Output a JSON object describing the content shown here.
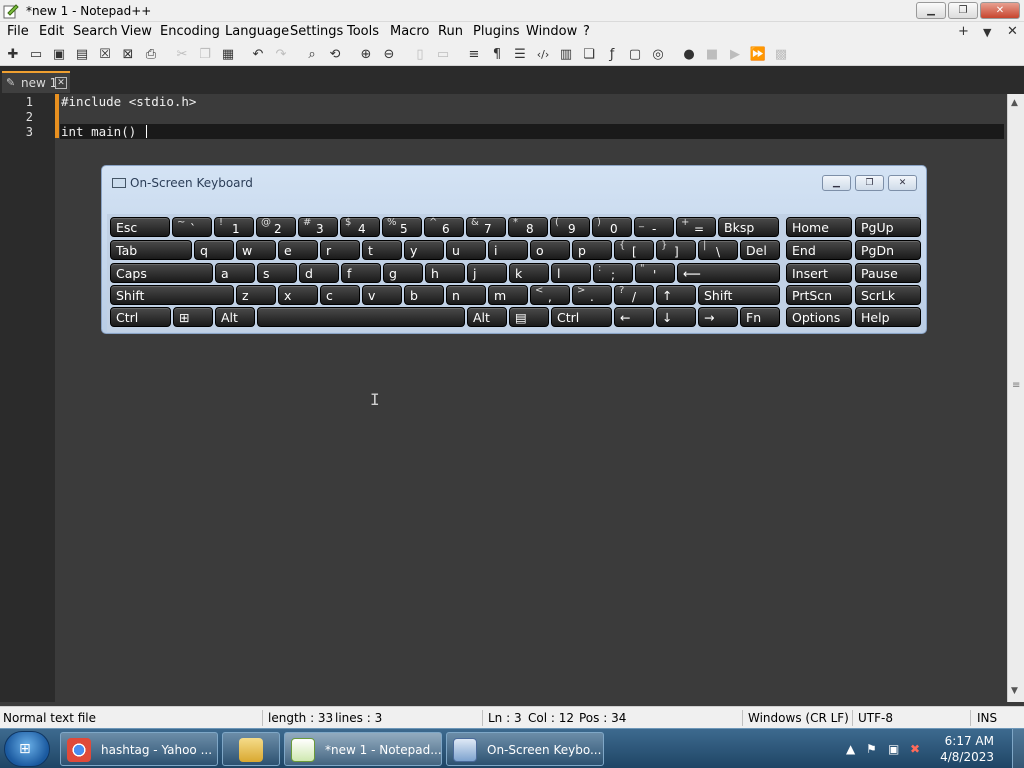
{
  "window": {
    "title": "*new 1 - Notepad++",
    "buttons": {
      "minimize": "▁",
      "maximize": "❐",
      "close": "✕"
    }
  },
  "menubar": {
    "items": [
      "File",
      "Edit",
      "Search",
      "View",
      "Encoding",
      "Language",
      "Settings",
      "Tools",
      "Macro",
      "Run",
      "Plugins",
      "Window",
      "?"
    ],
    "right": {
      "add": "+",
      "dropdown": "▼",
      "close": "✕"
    }
  },
  "toolbar": {
    "icons": [
      {
        "name": "new-file-icon",
        "glyph": "✚"
      },
      {
        "name": "open-file-icon",
        "glyph": "▭"
      },
      {
        "name": "save-icon",
        "glyph": "▣"
      },
      {
        "name": "save-all-icon",
        "glyph": "▤"
      },
      {
        "name": "close-file-icon",
        "glyph": "☒"
      },
      {
        "name": "close-all-icon",
        "glyph": "⊠"
      },
      {
        "name": "print-icon",
        "glyph": "⎙"
      },
      {
        "name": "cut-icon",
        "glyph": "✂"
      },
      {
        "name": "copy-icon",
        "glyph": "❐"
      },
      {
        "name": "paste-icon",
        "glyph": "▦"
      },
      {
        "name": "undo-icon",
        "glyph": "↶"
      },
      {
        "name": "redo-icon",
        "glyph": "↷"
      },
      {
        "name": "find-icon",
        "glyph": "⌕"
      },
      {
        "name": "replace-icon",
        "glyph": "⟲"
      },
      {
        "name": "zoom-in-icon",
        "glyph": "⊕"
      },
      {
        "name": "zoom-out-icon",
        "glyph": "⊖"
      },
      {
        "name": "sync-vertical-icon",
        "glyph": "▯"
      },
      {
        "name": "sync-horizontal-icon",
        "glyph": "▭"
      },
      {
        "name": "word-wrap-icon",
        "glyph": "≡"
      },
      {
        "name": "show-all-chars-icon",
        "glyph": "¶"
      },
      {
        "name": "indent-guide-icon",
        "glyph": "☰"
      },
      {
        "name": "xml-tag-icon",
        "glyph": "‹/›"
      },
      {
        "name": "document-map-icon",
        "glyph": "▥"
      },
      {
        "name": "document-list-icon",
        "glyph": "❏"
      },
      {
        "name": "function-list-icon",
        "glyph": "ƒ"
      },
      {
        "name": "monitor-icon",
        "glyph": "▢"
      },
      {
        "name": "folder-workspace-icon",
        "glyph": "◎"
      },
      {
        "name": "record-macro-icon",
        "glyph": "●"
      },
      {
        "name": "stop-macro-icon",
        "glyph": "■"
      },
      {
        "name": "play-macro-icon",
        "glyph": "▶"
      },
      {
        "name": "run-macro-multiple-icon",
        "glyph": "⏩"
      },
      {
        "name": "save-macro-icon",
        "glyph": "▩"
      }
    ]
  },
  "tabs": [
    {
      "label": "new 1",
      "icon": "pencil-icon",
      "close": "✕"
    }
  ],
  "editor": {
    "lines": [
      {
        "number": "1",
        "text": "#include <stdio.h>"
      },
      {
        "number": "2",
        "text": ""
      },
      {
        "number": "3",
        "text": "int main() "
      }
    ]
  },
  "statusbar": {
    "type": "Normal text file",
    "length": "length : 33",
    "lines": "lines : 3",
    "ln": "Ln : 3",
    "col": "Col : 12",
    "pos": "Pos : 34",
    "eol": "Windows (CR LF)",
    "encoding": "UTF-8",
    "mode": "INS"
  },
  "osk": {
    "title": "On-Screen Keyboard",
    "rows": [
      [
        {
          "label": "Esc",
          "w": 60
        },
        {
          "top": "~",
          "bottom": "`",
          "w": 40
        },
        {
          "top": "!",
          "bottom": "1",
          "w": 40
        },
        {
          "top": "@",
          "bottom": "2",
          "w": 40
        },
        {
          "top": "#",
          "bottom": "3",
          "w": 40
        },
        {
          "top": "$",
          "bottom": "4",
          "w": 40
        },
        {
          "top": "%",
          "bottom": "5",
          "w": 40
        },
        {
          "top": "^",
          "bottom": "6",
          "w": 40
        },
        {
          "top": "&",
          "bottom": "7",
          "w": 40
        },
        {
          "top": "*",
          "bottom": "8",
          "w": 40
        },
        {
          "top": "(",
          "bottom": "9",
          "w": 40
        },
        {
          "top": ")",
          "bottom": "0",
          "w": 40
        },
        {
          "top": "_",
          "bottom": "-",
          "w": 40
        },
        {
          "top": "+",
          "bottom": "=",
          "w": 40
        },
        {
          "label": "Bksp",
          "w": 61
        }
      ],
      [
        {
          "label": "Tab",
          "w": 82
        },
        {
          "label": "q",
          "w": 40
        },
        {
          "label": "w",
          "w": 40
        },
        {
          "label": "e",
          "w": 40
        },
        {
          "label": "r",
          "w": 40
        },
        {
          "label": "t",
          "w": 40
        },
        {
          "label": "y",
          "w": 40
        },
        {
          "label": "u",
          "w": 40
        },
        {
          "label": "i",
          "w": 40
        },
        {
          "label": "o",
          "w": 40
        },
        {
          "label": "p",
          "w": 40
        },
        {
          "top": "{",
          "bottom": "[",
          "w": 40
        },
        {
          "top": "}",
          "bottom": "]",
          "w": 40
        },
        {
          "top": "|",
          "bottom": "\\",
          "w": 40
        },
        {
          "label": "Del",
          "w": 40
        }
      ],
      [
        {
          "label": "Caps",
          "w": 103
        },
        {
          "label": "a",
          "w": 40
        },
        {
          "label": "s",
          "w": 40
        },
        {
          "label": "d",
          "w": 40
        },
        {
          "label": "f",
          "w": 40
        },
        {
          "label": "g",
          "w": 40
        },
        {
          "label": "h",
          "w": 40
        },
        {
          "label": "j",
          "w": 40
        },
        {
          "label": "k",
          "w": 40
        },
        {
          "label": "l",
          "w": 40
        },
        {
          "top": ":",
          "bottom": ";",
          "w": 40
        },
        {
          "top": "\"",
          "bottom": "'",
          "w": 40
        },
        {
          "label": "⟵",
          "w": 103
        }
      ],
      [
        {
          "label": "Shift",
          "w": 124
        },
        {
          "label": "z",
          "w": 40
        },
        {
          "label": "x",
          "w": 40
        },
        {
          "label": "c",
          "w": 40
        },
        {
          "label": "v",
          "w": 40
        },
        {
          "label": "b",
          "w": 40
        },
        {
          "label": "n",
          "w": 40
        },
        {
          "label": "m",
          "w": 40
        },
        {
          "top": "<",
          "bottom": ",",
          "w": 40
        },
        {
          "top": ">",
          "bottom": ".",
          "w": 40
        },
        {
          "top": "?",
          "bottom": "/",
          "w": 40
        },
        {
          "label": "↑",
          "w": 40
        },
        {
          "label": "Shift",
          "w": 82
        }
      ],
      [
        {
          "label": "Ctrl",
          "w": 61
        },
        {
          "label": "⊞",
          "w": 40
        },
        {
          "label": "Alt",
          "w": 40
        },
        {
          "label": "",
          "w": 208
        },
        {
          "label": "Alt",
          "w": 40
        },
        {
          "label": "▤",
          "w": 40
        },
        {
          "label": "Ctrl",
          "w": 61
        },
        {
          "label": "←",
          "w": 40
        },
        {
          "label": "↓",
          "w": 40
        },
        {
          "label": "→",
          "w": 40
        },
        {
          "label": "Fn",
          "w": 40
        }
      ]
    ],
    "nav": [
      [
        "Home",
        "PgUp"
      ],
      [
        "End",
        "PgDn"
      ],
      [
        "Insert",
        "Pause"
      ],
      [
        "PrtScn",
        "ScrLk"
      ],
      [
        "Options",
        "Help"
      ]
    ]
  },
  "taskbar": {
    "tasks": [
      {
        "label": "hashtag - Yahoo ...",
        "icon": "chrome-icon",
        "color": "#e04a3a"
      },
      {
        "label": "",
        "icon": "explorer-folder-icon",
        "color": "#e8c25a"
      },
      {
        "label": "*new 1 - Notepad...",
        "icon": "notepad-plus-plus-icon",
        "color": "#9fd26a"
      },
      {
        "label": "On-Screen Keybo...",
        "icon": "keyboard-icon",
        "color": "#8fb3dd"
      }
    ],
    "clock": {
      "time": "6:17 AM",
      "date": "4/8/2023"
    }
  }
}
